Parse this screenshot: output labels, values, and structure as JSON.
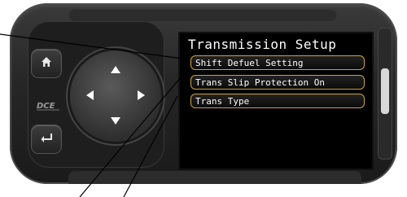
{
  "screen": {
    "title": "Transmission Setup",
    "menu": [
      {
        "label": "Shift Defuel Setting"
      },
      {
        "label": "Trans Slip Protection On"
      },
      {
        "label": "Trans Type"
      }
    ]
  },
  "device": {
    "buttons": {
      "home_icon": "home-icon",
      "back_icon": "enter-icon"
    },
    "logo_text": "DCE"
  },
  "colors": {
    "menu_border": "#c9a23a",
    "screen_bg": "#000000",
    "body": "#262626"
  }
}
